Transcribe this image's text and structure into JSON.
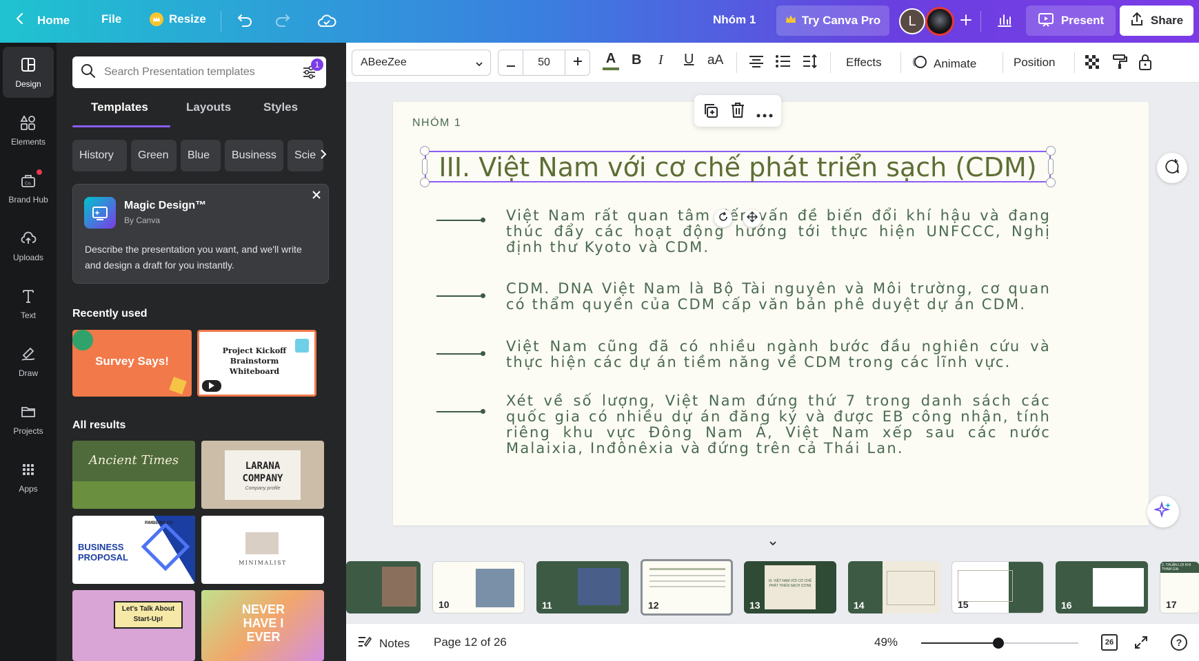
{
  "topbar": {
    "home": "Home",
    "file": "File",
    "resize": "Resize",
    "doc_title": "Nhóm 1",
    "try_pro": "Try Canva Pro",
    "avatar_letter": "L",
    "present": "Present",
    "share": "Share"
  },
  "rail": {
    "items": [
      {
        "label": "Design",
        "icon": "layout-icon"
      },
      {
        "label": "Elements",
        "icon": "shapes-icon"
      },
      {
        "label": "Brand Hub",
        "icon": "brand-icon"
      },
      {
        "label": "Uploads",
        "icon": "cloud-upload-icon"
      },
      {
        "label": "Text",
        "icon": "text-icon"
      },
      {
        "label": "Draw",
        "icon": "pen-icon"
      },
      {
        "label": "Projects",
        "icon": "folder-icon"
      },
      {
        "label": "Apps",
        "icon": "apps-grid-icon"
      }
    ]
  },
  "panel": {
    "search_placeholder": "Search Presentation templates",
    "filter_badge": "1",
    "tabs": [
      "Templates",
      "Layouts",
      "Styles"
    ],
    "chips": [
      "History",
      "Green",
      "Blue",
      "Business",
      "Scie"
    ],
    "magic": {
      "title": "Magic Design™",
      "by": "By Canva",
      "desc": "Describe the presentation you want, and we'll write and design a draft for you instantly."
    },
    "recent_title": "Recently used",
    "recent": [
      {
        "title": "Survey Says!"
      },
      {
        "title": "Project Kickoff Brainstorm Whiteboard"
      }
    ],
    "all_title": "All results",
    "results": [
      {
        "title": "Ancient Times"
      },
      {
        "title": "LARANA COMPANY",
        "sub": "Company profile"
      },
      {
        "title": "BUSINESS PROPOSAL",
        "brand": "RIMBERIO.CO"
      },
      {
        "title": "MINIMALIST"
      },
      {
        "title": "Let's Talk About Start-Up!"
      },
      {
        "title": "NEVER HAVE I EVER"
      }
    ]
  },
  "toolbar": {
    "font": "ABeeZee",
    "size": "50",
    "effects": "Effects",
    "animate": "Animate",
    "position": "Position"
  },
  "slide": {
    "header": "NHÓM 1",
    "title": "III. Việt Nam với cơ chế phát triển sạch (CDM)",
    "paragraphs": [
      "Việt Nam rất quan tâm đến vấn đề biến đổi khí hậu và đang thúc đẩy các hoạt động hướng tới thực hiện UNFCCC, Nghị định thư Kyoto và CDM.",
      "CDM. DNA Việt Nam là Bộ Tài nguyên và Môi trường, cơ quan có thẩm quyền của CDM cấp văn bản phê duyệt dự án CDM.",
      "Việt Nam cũng đã có nhiều ngành bước đầu nghiên cứu và thực hiện các dự án tiềm năng về CDM trong các lĩnh vực.",
      "Xét về số lượng, Việt Nam đứng thứ 7 trong danh sách các quốc gia có nhiều dự án đăng ký và được EB công nhận, tính riêng khu vực Đông Nam Á, Việt Nam xếp sau các nước Malaixia, Inđônêxia và đứng trên cả Thái Lan."
    ]
  },
  "filmstrip": {
    "pages": [
      "10",
      "11",
      "12",
      "13",
      "14",
      "15",
      "16",
      "17"
    ],
    "current": "12",
    "p13_text": "III. VIỆT NAM VỚI CƠ CHẾ PHÁT TRIỂN SẠCH (CDM)",
    "p17_text": "2. THUẬN LỢI KHI THAM GIA"
  },
  "bottombar": {
    "notes": "Notes",
    "page": "Page 12 of 26",
    "zoom": "49%",
    "zoom_fraction": 0.49,
    "page_count": "26"
  }
}
